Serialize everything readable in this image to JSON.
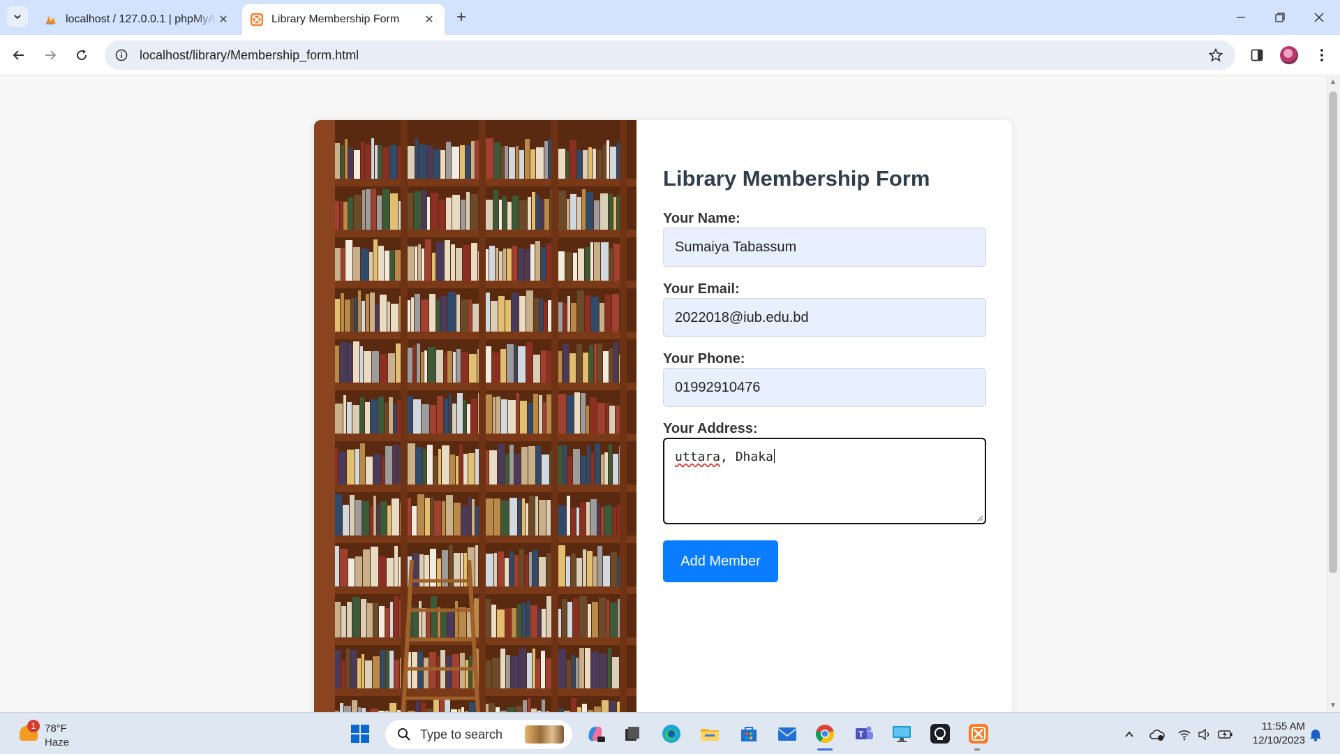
{
  "browser": {
    "tabs": [
      {
        "title": "localhost / 127.0.0.1 | phpMyAdmin",
        "active": false
      },
      {
        "title": "Library Membership Form",
        "active": true
      }
    ],
    "url": "localhost/library/Membership_form.html"
  },
  "form": {
    "title": "Library Membership Form",
    "name_label": "Your Name:",
    "name_value": "Sumaiya Tabassum",
    "email_label": "Your Email:",
    "email_value": "2022018@iub.edu.bd",
    "phone_label": "Your Phone:",
    "phone_value": "01992910476",
    "address_label": "Your Address:",
    "address_value_part1": "uttara",
    "address_value_part2": ", Dhaka",
    "submit_label": "Add Member"
  },
  "taskbar": {
    "weather_badge": "1",
    "weather_temp": "78°F",
    "weather_condition": "Haze",
    "search_placeholder": "Type to search",
    "time": "11:55 AM",
    "date": "12/10/2023"
  },
  "colors": {
    "accent": "#0a7cff",
    "tabbar": "#d3e3fd",
    "field_bg": "#e8f0fe"
  }
}
